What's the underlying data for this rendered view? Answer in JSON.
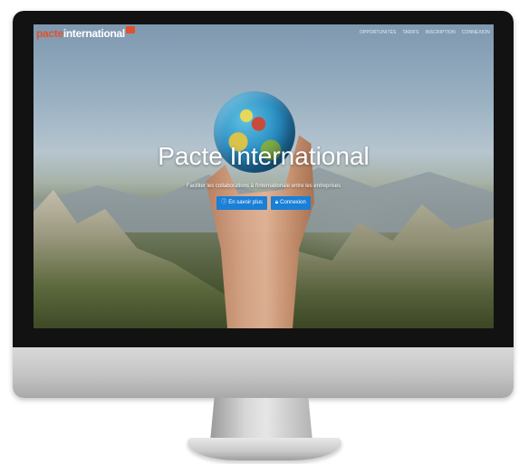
{
  "navbar": {
    "brand_prefix": "pacte",
    "brand_main": "international",
    "links": [
      "OPPORTUNITÉS",
      "TARIFS",
      "INSCRIPTION",
      "CONNEXION"
    ]
  },
  "hero": {
    "title": "Pacte International",
    "subtitle": "Faciliter les collaborations à l'internationale entre les entreprises",
    "buttons": [
      {
        "label": "En savoir plus",
        "icon": "info-icon"
      },
      {
        "label": "Connexion",
        "icon": "lock-icon"
      }
    ]
  },
  "colors": {
    "accent": "#e0522b",
    "button": "#1a7fd6",
    "bezel": "#121212"
  }
}
